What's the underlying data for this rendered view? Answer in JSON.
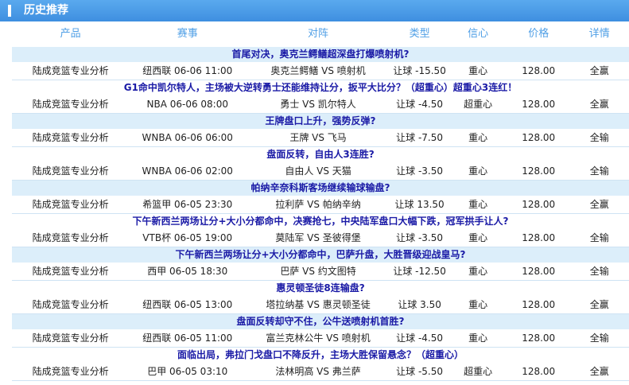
{
  "header": {
    "title": "历史推荐"
  },
  "columns": [
    "产品",
    "赛事",
    "对阵",
    "类型",
    "信心",
    "价格",
    "详情"
  ],
  "rows": [
    {
      "title": "首尾对决，奥克兰鳄鳝超深盘打爆喷射机?",
      "product": "陆成竞篮专业分析",
      "event": "纽西联 06-06 11:00",
      "match": "奥克兰鳄鳝 VS 喷射机",
      "type": "让球 -15.50",
      "confidence": "重心",
      "price": "128.00",
      "result": "全赢"
    },
    {
      "title": "G1命中凯尔特人，主场被大逆转勇士还能维持让分，扳平大比分？（超重心）超重心3连红！",
      "product": "陆成竞篮专业分析",
      "event": "NBA 06-06 08:00",
      "match": "勇士 VS 凯尔特人",
      "type": "让球 -4.50",
      "confidence": "超重心",
      "price": "128.00",
      "result": "全赢"
    },
    {
      "title": "王牌盘口上升，强势反弹?",
      "product": "陆成竞篮专业分析",
      "event": "WNBA 06-06 06:00",
      "match": "王牌 VS 飞马",
      "type": "让球 -7.50",
      "confidence": "重心",
      "price": "128.00",
      "result": "全输"
    },
    {
      "title": "盘面反转，自由人3连胜?",
      "product": "陆成竞篮专业分析",
      "event": "WNBA 06-06 02:00",
      "match": "自由人 VS 天猫",
      "type": "让球 -3.50",
      "confidence": "重心",
      "price": "128.00",
      "result": "全输"
    },
    {
      "title": "帕纳辛奈科斯客场继续输球输盘?",
      "product": "陆成竞篮专业分析",
      "event": "希篮甲 06-05 23:30",
      "match": "拉利萨 VS 帕纳辛纳",
      "type": "让球 13.50",
      "confidence": "重心",
      "price": "128.00",
      "result": "全赢"
    },
    {
      "title": "下午新西兰两场让分+大小分都命中，决赛抢七，中央陆军盘口大幅下跌，冠军拱手让人?",
      "product": "陆成竞篮专业分析",
      "event": "VTB杯 06-05 19:00",
      "match": "莫陆军 VS 圣彼得堡",
      "type": "让球 -3.50",
      "confidence": "重心",
      "price": "128.00",
      "result": "全输"
    },
    {
      "title": "下午新西兰两场让分+大小分都命中，巴萨升盘，大胜晋级迎战皇马?",
      "product": "陆成竞篮专业分析",
      "event": "西甲 06-05 18:30",
      "match": "巴萨 VS 约文图特",
      "type": "让球 -12.50",
      "confidence": "重心",
      "price": "128.00",
      "result": "全输"
    },
    {
      "title": "惠灵顿圣徒8连输盘?",
      "product": "陆成竞篮专业分析",
      "event": "纽西联 06-05 13:00",
      "match": "塔拉纳基 VS 惠灵顿圣徒",
      "type": "让球 3.50",
      "confidence": "重心",
      "price": "128.00",
      "result": "全赢"
    },
    {
      "title": "盘面反转却守不住，公牛送喷射机首胜?",
      "product": "陆成竞篮专业分析",
      "event": "纽西联 06-05 11:00",
      "match": "富兰克林公牛 VS 喷射机",
      "type": "让球 -4.50",
      "confidence": "重心",
      "price": "128.00",
      "result": "全输"
    },
    {
      "title": "面临出局，弗拉门戈盘口不降反升，主场大胜保留悬念？（超重心）",
      "product": "陆成竞篮专业分析",
      "event": "巴甲 06-05 03:10",
      "match": "法林明高 VS 弗兰萨",
      "type": "让球 -5.50",
      "confidence": "超重心",
      "price": "128.00",
      "result": "全赢"
    }
  ]
}
